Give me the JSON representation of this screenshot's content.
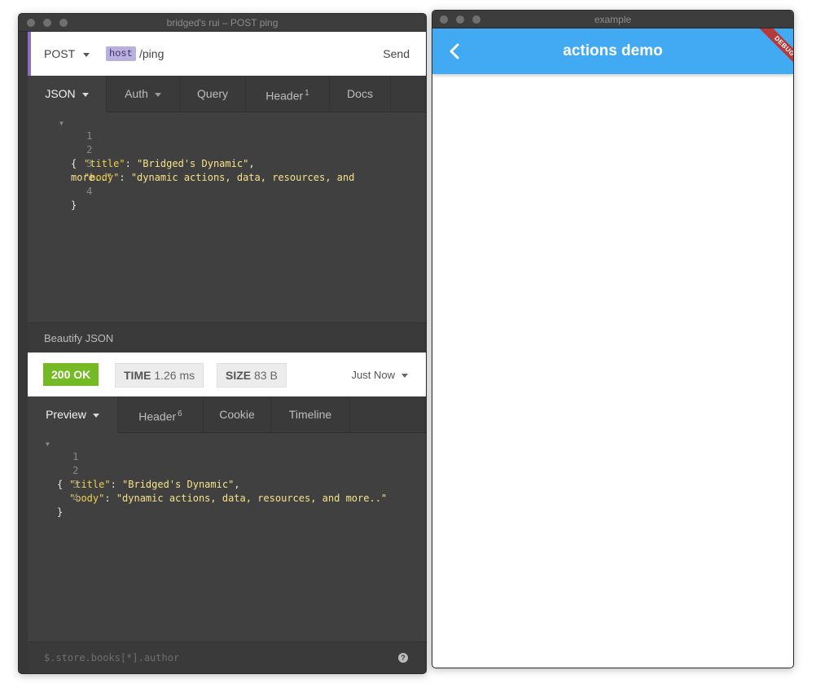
{
  "left_window": {
    "title": "bridged's rui – POST ping",
    "request": {
      "method": "POST",
      "host_tag": "host",
      "path": "/ping",
      "send_label": "Send"
    },
    "request_tabs": [
      {
        "label": "JSON"
      },
      {
        "label": "Auth"
      },
      {
        "label": "Query"
      },
      {
        "label": "Header",
        "badge": "1"
      },
      {
        "label": "Docs"
      }
    ],
    "request_body_lines": [
      {
        "no": "1",
        "text": "{"
      },
      {
        "no": "2",
        "key": "\"title\"",
        "sep": ": ",
        "value": "\"Bridged's Dynamic\"",
        "tail": ","
      },
      {
        "no": "3",
        "key": "\"body\"",
        "sep": ": ",
        "value": "\"dynamic actions, data, resources, and",
        "wrap": "more..\""
      },
      {
        "no": "4",
        "text": "}"
      }
    ],
    "beautify_label": "Beautify JSON",
    "response": {
      "status": "200 OK",
      "time_label": "TIME",
      "time_value": "1.26 ms",
      "size_label": "SIZE",
      "size_value": "83 B",
      "when": "Just Now"
    },
    "response_tabs": [
      {
        "label": "Preview"
      },
      {
        "label": "Header",
        "badge": "6"
      },
      {
        "label": "Cookie"
      },
      {
        "label": "Timeline"
      }
    ],
    "response_body_lines": [
      {
        "no": "1",
        "text": "{"
      },
      {
        "no": "2",
        "key": "\"title\"",
        "sep": ": ",
        "value": "\"Bridged's Dynamic\"",
        "tail": ","
      },
      {
        "no": "3",
        "key": "\"body\"",
        "sep": ": ",
        "value": "\"dynamic actions, data, resources, and more..\""
      },
      {
        "no": "4",
        "text": "}"
      }
    ],
    "filter_placeholder": "$.store.books[*].author",
    "help_glyph": "?"
  },
  "right_window": {
    "title": "example",
    "appbar_title": "actions demo",
    "debug_banner": "DEBUG",
    "accent_color": "#42aaf3"
  },
  "colors": {
    "request_accent": "#8e6fc2",
    "status_ok": "#75ba24"
  }
}
